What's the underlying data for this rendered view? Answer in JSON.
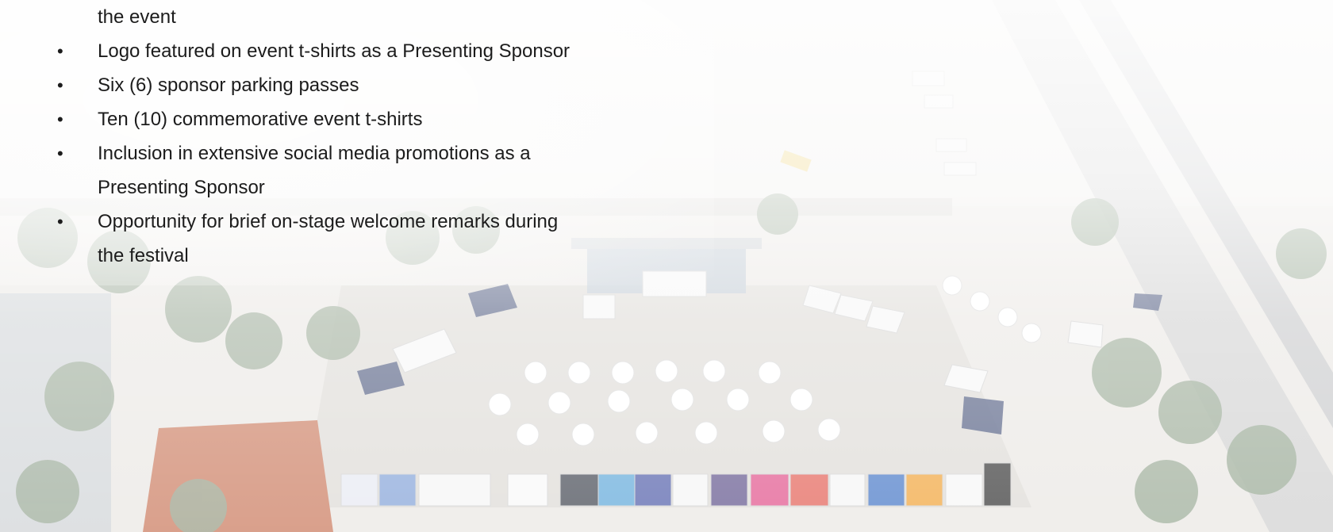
{
  "background": {
    "photo": "aerial-festival-plaza-photo",
    "colors": {
      "fog": "#ffffff",
      "text": "#1c1c1c",
      "ground": "#e9e6e2",
      "roof": "#c9775a",
      "pier": "#cfcfcf"
    }
  },
  "perks": {
    "items": [
      {
        "text": "the event",
        "bullet": false
      },
      {
        "text": "Logo featured on event t-shirts as a Presenting Sponsor",
        "bullet": true
      },
      {
        "text": "Six (6) sponsor parking passes",
        "bullet": true
      },
      {
        "text": "Ten (10) commemorative event t-shirts",
        "bullet": true
      },
      {
        "text": "Inclusion in extensive social media promotions as a Presenting Sponsor",
        "bullet": true
      },
      {
        "text": "Opportunity for brief on-stage welcome remarks during the festival",
        "bullet": true
      }
    ],
    "lines": [
      "the event",
      "Logo featured on event t-shirts as a Presenting Sponsor",
      "Six (6) sponsor parking passes",
      "Ten (10) commemorative event t-shirts",
      "Inclusion in extensive social media promotions as a",
      "Presenting Sponsor",
      "Opportunity for brief on-stage welcome remarks during",
      "the festival"
    ],
    "bullet_char": "•"
  }
}
